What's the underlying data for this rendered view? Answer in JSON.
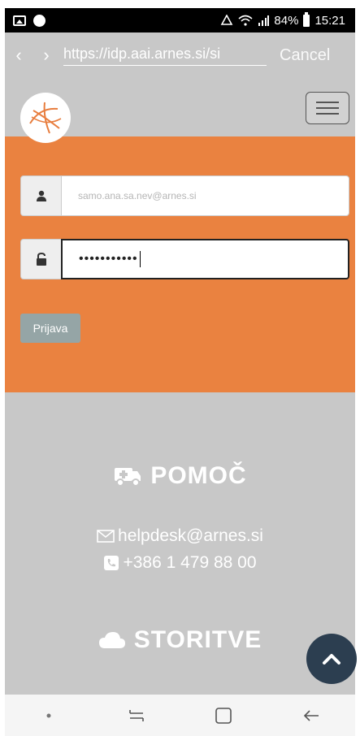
{
  "status_bar": {
    "battery": "84%",
    "time": "15:21",
    "icons": [
      "gallery-icon",
      "notification-icon",
      "data-saver-icon",
      "wifi-icon",
      "signal-icon",
      "battery-icon"
    ]
  },
  "browser": {
    "url": "https://idp.aai.arnes.si/si",
    "cancel_label": "Cancel",
    "back_glyph": "‹",
    "forward_glyph": "›"
  },
  "login": {
    "username_value": "samo.ana.sa.nev@arnes.si",
    "password_value": "•••••••••••",
    "submit_label": "Prijava"
  },
  "footer": {
    "help_title": "POMOČ",
    "email": "helpdesk@arnes.si",
    "phone": "+386 1 479 88 00",
    "services_title": "STORITVE"
  },
  "colors": {
    "orange": "#ea8240",
    "gray": "#c8c8c8",
    "button_gray": "#95a5a6",
    "scroll_top": "#2c3e50"
  }
}
